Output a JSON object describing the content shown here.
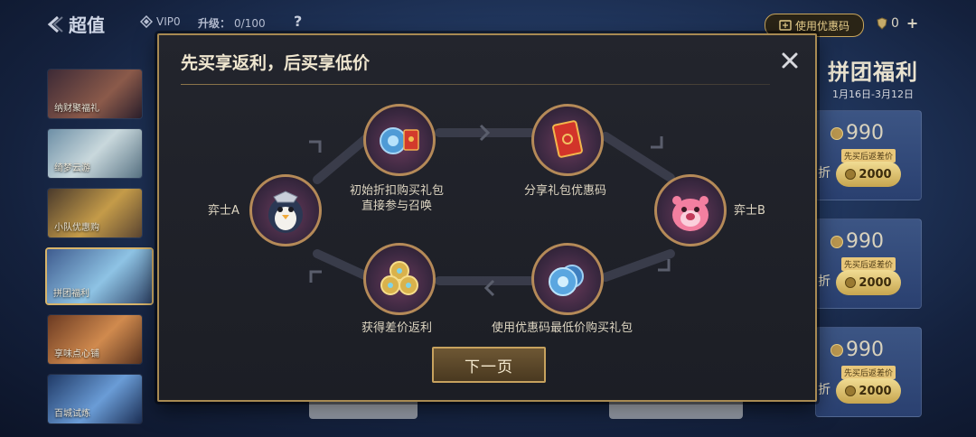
{
  "header": {
    "back_title": "超值",
    "vip_level": "VIP0",
    "upgrade_label": "升级：",
    "upgrade_progress": "0/100",
    "help_label": "?",
    "coupon_button": "使用优惠码",
    "currency_amount": "0",
    "currency_plus": "+"
  },
  "sidebar": {
    "items": [
      {
        "label": "纳财聚福礼"
      },
      {
        "label": "绮梦云游"
      },
      {
        "label": "小队优惠购"
      },
      {
        "label": "拼团福利",
        "active": true
      },
      {
        "label": "享味点心铺"
      },
      {
        "label": "百城试炼"
      }
    ]
  },
  "promo": {
    "title": "拼团福利",
    "date_range": "1月16日-3月12日",
    "cards": [
      {
        "price": "990",
        "tag": "先买后返差价",
        "discount_suffix": "折",
        "cta_price": "2000"
      },
      {
        "price": "990",
        "tag": "先买后返差价",
        "discount_suffix": "折",
        "cta_price": "2000"
      },
      {
        "price": "990",
        "tag": "先买后返差价",
        "discount_suffix": "折",
        "cta_price": "2000"
      }
    ]
  },
  "modal": {
    "title": "先买享返利，后买享低价",
    "close_label": "×",
    "nodes": {
      "player_a": {
        "caption": "弈士A",
        "icon": "penguin-avatar-icon"
      },
      "player_b": {
        "caption": "弈士B",
        "icon": "pink-creature-avatar-icon"
      },
      "step_buy": {
        "caption_line1": "初始折扣购买礼包",
        "caption_line2": "直接参与召唤",
        "icon": "orb-and-red-packet-icon"
      },
      "step_share": {
        "caption": "分享礼包优惠码",
        "icon": "red-packet-icon"
      },
      "step_lowest": {
        "caption": "使用优惠码最低价购买礼包",
        "icon": "blue-orbs-icon"
      },
      "step_rebate": {
        "caption": "获得差价返利",
        "icon": "gold-coins-icon"
      }
    },
    "next_button": "下一页"
  },
  "colors": {
    "accent_gold": "#c9a65d",
    "modal_bg": "#1f2128",
    "node_border": "#b58a58"
  }
}
